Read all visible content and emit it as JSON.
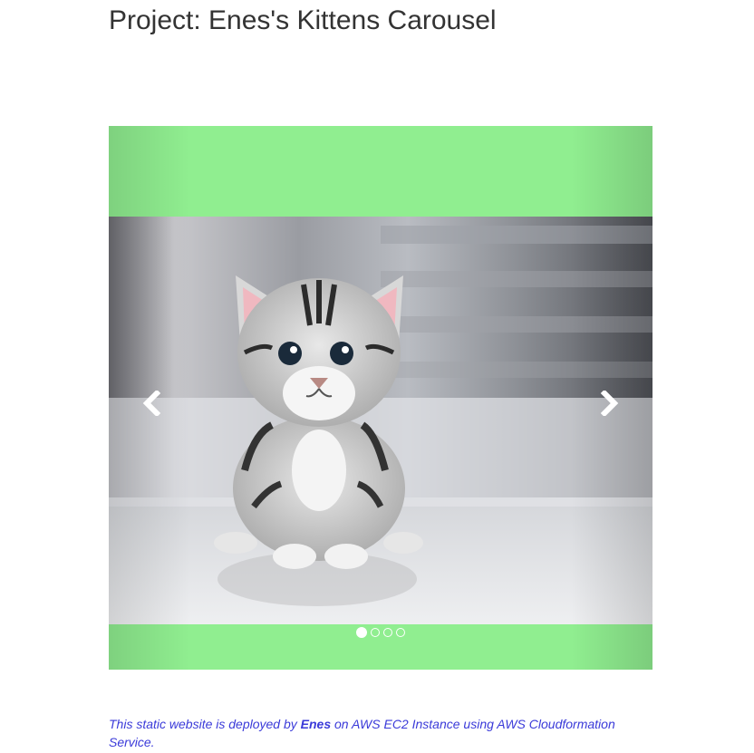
{
  "page": {
    "title": "Project: Enes's Kittens Carousel"
  },
  "carousel": {
    "background_color": "#90ee90",
    "slide_image": "kitten-photo",
    "slide_count": 4,
    "active_slide": 1,
    "prev_icon": "chevron-left-icon",
    "next_icon": "chevron-right-icon"
  },
  "footer": {
    "text_before": "This static website is deployed by ",
    "author": "Enes",
    "text_after": " on AWS EC2 Instance using AWS Cloudformation Service.",
    "color": "#3a3ad9"
  }
}
